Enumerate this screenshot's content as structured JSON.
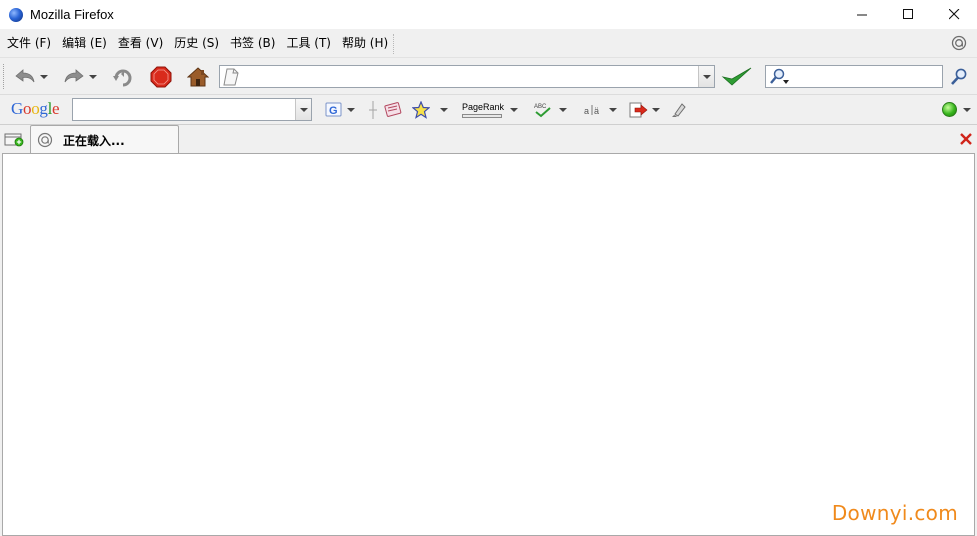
{
  "window": {
    "title": "Mozilla Firefox"
  },
  "menubar": {
    "items": [
      {
        "label": "文件 (F)"
      },
      {
        "label": "编辑 (E)"
      },
      {
        "label": "查看 (V)"
      },
      {
        "label": "历史 (S)"
      },
      {
        "label": "书签 (B)"
      },
      {
        "label": "工具 (T)"
      },
      {
        "label": "帮助 (H)"
      }
    ]
  },
  "navbar": {
    "url_value": "",
    "search_value": ""
  },
  "google_toolbar": {
    "logo_letters": [
      "G",
      "o",
      "o",
      "g",
      "l",
      "e"
    ],
    "logo_colors": [
      "#2f67d6",
      "#d8372b",
      "#e8b511",
      "#2f67d6",
      "#2a9a2a",
      "#d8372b"
    ],
    "search_value": "",
    "pagerank_label": "PageRank",
    "status_color": "#37b51d"
  },
  "tabs": [
    {
      "label": "正在载入...",
      "loading": true
    }
  ],
  "watermark": "Downyi.com"
}
